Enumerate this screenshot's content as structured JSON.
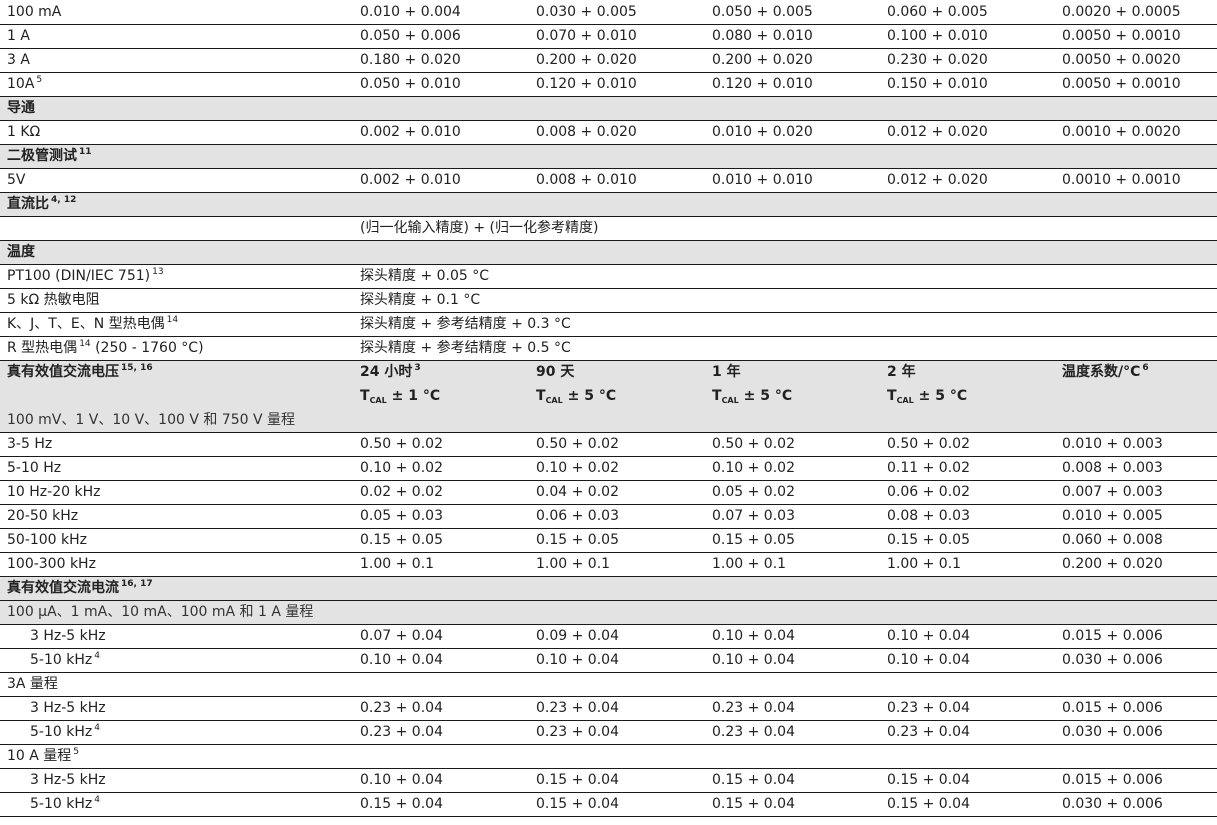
{
  "rows": [
    {
      "type": "data",
      "label": "100 mA",
      "cells": [
        "0.010 + 0.004",
        "0.030 + 0.005",
        "0.050 + 0.005",
        "0.060 + 0.005",
        "0.0020 + 0.0005"
      ]
    },
    {
      "type": "data",
      "label": "1 A",
      "cells": [
        "0.050 + 0.006",
        "0.070 + 0.010",
        "0.080 + 0.010",
        "0.100 + 0.010",
        "0.0050 + 0.0010"
      ]
    },
    {
      "type": "data",
      "label": "3 A",
      "cells": [
        "0.180 + 0.020",
        "0.200 + 0.020",
        "0.200 + 0.020",
        "0.230 + 0.020",
        "0.0050 + 0.0020"
      ]
    },
    {
      "type": "data",
      "label": "10A",
      "sup": "5",
      "cells": [
        "0.050 + 0.010",
        "0.120 + 0.010",
        "0.120 + 0.010",
        "0.150 + 0.010",
        "0.0050 + 0.0010"
      ]
    },
    {
      "type": "section",
      "label": "导通"
    },
    {
      "type": "data",
      "label": "1 KΩ",
      "cells": [
        "0.002 + 0.010",
        "0.008 + 0.020",
        "0.010 + 0.020",
        "0.012 + 0.020",
        "0.0010 + 0.0020"
      ]
    },
    {
      "type": "section",
      "label": "二极管测试",
      "sup": "11"
    },
    {
      "type": "data",
      "label": "5V",
      "cells": [
        "0.002 + 0.010",
        "0.008 + 0.010",
        "0.010 + 0.010",
        "0.012 + 0.020",
        "0.0010 + 0.0010"
      ]
    },
    {
      "type": "section",
      "label": "直流比",
      "sup": "4, 12"
    },
    {
      "type": "span",
      "label": "",
      "text": "(归一化输入精度) + (归一化参考精度)"
    },
    {
      "type": "section",
      "label": "温度"
    },
    {
      "type": "span",
      "label": "PT100 (DIN/IEC 751)",
      "sup": "13",
      "text": "探头精度 + 0.05 °C"
    },
    {
      "type": "span",
      "label": "5 kΩ 热敏电阻",
      "text": "探头精度 + 0.1 °C"
    },
    {
      "type": "span",
      "label": "K、J、T、E、N 型热电偶",
      "sup": "14",
      "text": "探头精度 + 参考结精度 + 0.3 °C"
    },
    {
      "type": "span",
      "label": "R 型热电偶",
      "sup": "14",
      "label2": " (250 - 1760 °C)",
      "text": "探头精度 + 参考结精度 + 0.5 °C"
    }
  ],
  "ac_voltage_header": {
    "title": "真有效值交流电压",
    "title_sup": "15, 16",
    "cols": [
      {
        "top": "24 小时",
        "top_sup": "3",
        "bottom": "± 1 °C"
      },
      {
        "top": "90 天",
        "bottom": "± 5 °C"
      },
      {
        "top": "1 年",
        "bottom": "± 5 °C"
      },
      {
        "top": "2 年",
        "bottom": "± 5 °C"
      },
      {
        "top": "温度系数/°C",
        "top_sup": "6",
        "bottom": ""
      }
    ],
    "tcal_main": "T",
    "tcal_sub": "CAL",
    "ranges": "100 mV、1 V、10 V、100 V 和 750 V 量程"
  },
  "rows2": [
    {
      "type": "data",
      "label": "3-5 Hz",
      "cells": [
        "0.50 + 0.02",
        "0.50 + 0.02",
        "0.50 + 0.02",
        "0.50 + 0.02",
        "0.010 + 0.003"
      ]
    },
    {
      "type": "data",
      "label": "5-10 Hz",
      "cells": [
        "0.10 + 0.02",
        "0.10 + 0.02",
        "0.10 + 0.02",
        "0.11 + 0.02",
        "0.008 + 0.003"
      ]
    },
    {
      "type": "data",
      "label": "10 Hz-20 kHz",
      "cells": [
        "0.02 + 0.02",
        "0.04 + 0.02",
        "0.05 + 0.02",
        "0.06 + 0.02",
        "0.007 + 0.003"
      ]
    },
    {
      "type": "data",
      "label": "20-50 kHz",
      "cells": [
        "0.05 + 0.03",
        "0.06 + 0.03",
        "0.07 + 0.03",
        "0.08 + 0.03",
        "0.010 + 0.005"
      ]
    },
    {
      "type": "data",
      "label": "50-100 kHz",
      "cells": [
        "0.15 + 0.05",
        "0.15 + 0.05",
        "0.15 + 0.05",
        "0.15 + 0.05",
        "0.060 + 0.008"
      ]
    },
    {
      "type": "data",
      "label": "100-300 kHz",
      "cells": [
        "1.00 + 0.1",
        "1.00 + 0.1",
        "1.00 + 0.1",
        "1.00 + 0.1",
        "0.200 + 0.020"
      ]
    },
    {
      "type": "section",
      "label": "真有效值交流电流",
      "sup": "16, 17"
    },
    {
      "type": "subsection",
      "label": "100 µA、1 mA、10 mA、100 mA 和 1 A 量程"
    },
    {
      "type": "data",
      "indent": true,
      "label": "3 Hz-5 kHz",
      "cells": [
        "0.07 + 0.04",
        "0.09 + 0.04",
        "0.10 + 0.04",
        "0.10 + 0.04",
        "0.015 + 0.006"
      ]
    },
    {
      "type": "data",
      "indent": true,
      "label": "5-10 kHz",
      "sup": "4",
      "cells": [
        "0.10 + 0.04",
        "0.10 + 0.04",
        "0.10 + 0.04",
        "0.10 + 0.04",
        "0.030 + 0.006"
      ]
    },
    {
      "type": "plain",
      "label": "3A 量程"
    },
    {
      "type": "data",
      "indent": true,
      "label": "3 Hz-5 kHz",
      "cells": [
        "0.23 + 0.04",
        "0.23 + 0.04",
        "0.23 + 0.04",
        "0.23 + 0.04",
        "0.015 + 0.006"
      ]
    },
    {
      "type": "data",
      "indent": true,
      "label": "5-10 kHz",
      "sup": "4",
      "cells": [
        "0.23 + 0.04",
        "0.23 + 0.04",
        "0.23 + 0.04",
        "0.23 + 0.04",
        "0.030 + 0.006"
      ]
    },
    {
      "type": "plain",
      "label": "10 A 量程",
      "sup": "5"
    },
    {
      "type": "data",
      "indent": true,
      "label": "3 Hz-5 kHz",
      "cells": [
        "0.10 + 0.04",
        "0.15 + 0.04",
        "0.15 + 0.04",
        "0.15 + 0.04",
        "0.015 + 0.006"
      ]
    },
    {
      "type": "data",
      "indent": true,
      "label": "5-10 kHz",
      "sup": "4",
      "cells": [
        "0.15 + 0.04",
        "0.15 + 0.04",
        "0.15 + 0.04",
        "0.15 + 0.04",
        "0.030 + 0.006"
      ]
    }
  ]
}
